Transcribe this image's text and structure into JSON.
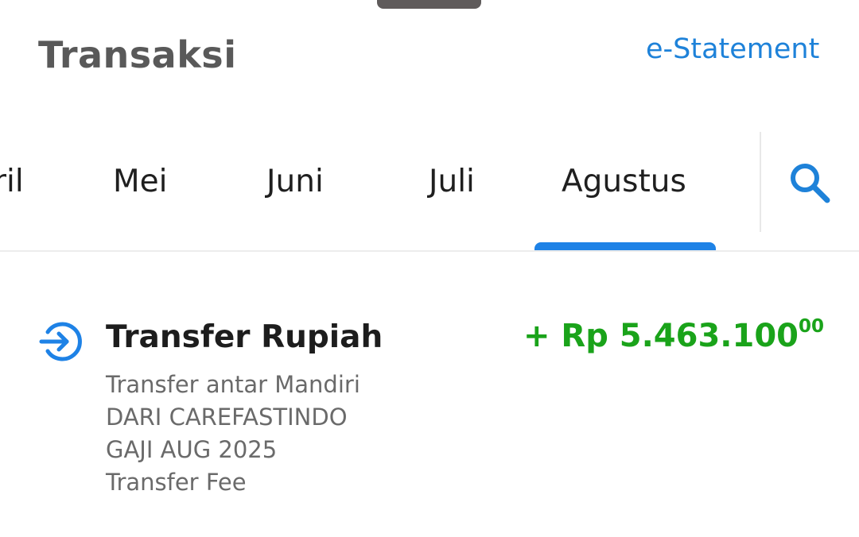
{
  "header": {
    "title": "Transaksi",
    "e_statement_label": "e-Statement"
  },
  "tabs": {
    "items": [
      {
        "label": "ril"
      },
      {
        "label": "Mei"
      },
      {
        "label": "Juni"
      },
      {
        "label": "Juli"
      },
      {
        "label": "Agustus",
        "active": true
      }
    ],
    "search_icon": "search-icon"
  },
  "transaction": {
    "icon": "transfer-in-icon",
    "title": "Transfer Rupiah",
    "description_lines": [
      "Transfer antar Mandiri",
      "DARI CAREFASTINDO",
      "GAJI AUG 2025",
      "Transfer Fee"
    ],
    "amount_main": "+ Rp 5.463.100",
    "amount_decimals": "00"
  },
  "colors": {
    "accent": "#1e82d9",
    "amount": "#1aa31a",
    "title": "#595959"
  }
}
